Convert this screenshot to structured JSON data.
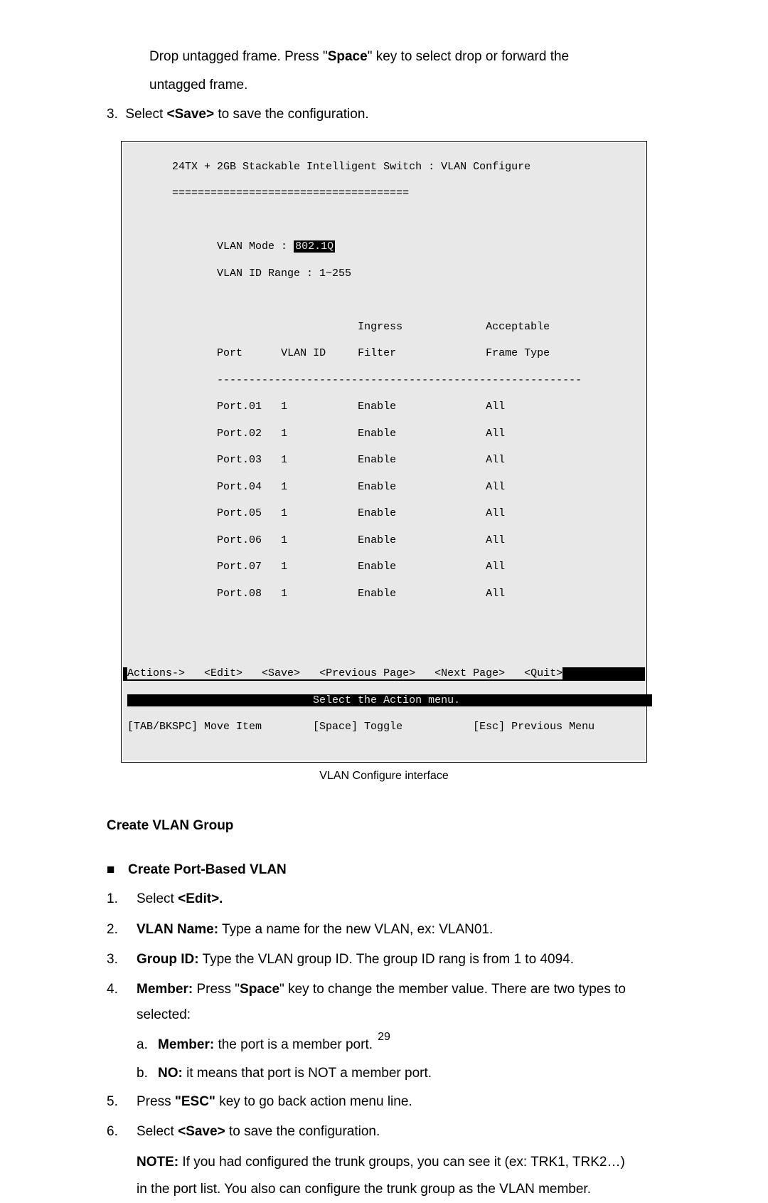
{
  "intro": {
    "line1_pre": "Drop untagged frame. Press \"",
    "line1_bold": "Space",
    "line1_post": "\" key to select drop or forward the",
    "line2": "untagged frame."
  },
  "step3": {
    "num": "3.",
    "pre": "Select ",
    "bold": "<Save>",
    "post": " to save the configuration."
  },
  "terminal": {
    "title": "24TX + 2GB Stackable Intelligent Switch : VLAN Configure",
    "divider": "=====================================",
    "vlan_mode_label": "VLAN Mode : ",
    "vlan_mode_value": "802.1Q",
    "vlan_id_range": "VLAN ID Range : 1~255",
    "hdr_port": "Port",
    "hdr_vlanid": "VLAN ID",
    "hdr_ingress1": "Ingress",
    "hdr_ingress2": "Filter",
    "hdr_accept1": "Acceptable",
    "hdr_accept2": "Frame Type",
    "hline": "---------------------------------------------------------",
    "rows": [
      {
        "port": "Port.01",
        "vid": "1",
        "filter": "Enable",
        "type": "All"
      },
      {
        "port": "Port.02",
        "vid": "1",
        "filter": "Enable",
        "type": "All"
      },
      {
        "port": "Port.03",
        "vid": "1",
        "filter": "Enable",
        "type": "All"
      },
      {
        "port": "Port.04",
        "vid": "1",
        "filter": "Enable",
        "type": "All"
      },
      {
        "port": "Port.05",
        "vid": "1",
        "filter": "Enable",
        "type": "All"
      },
      {
        "port": "Port.06",
        "vid": "1",
        "filter": "Enable",
        "type": "All"
      },
      {
        "port": "Port.07",
        "vid": "1",
        "filter": "Enable",
        "type": "All"
      },
      {
        "port": "Port.08",
        "vid": "1",
        "filter": "Enable",
        "type": "All"
      }
    ],
    "actions_prefix": "Actions->   ",
    "actions_edit": "<Edit>",
    "actions_save": "   <Save>   ",
    "actions_prev": "<Previous Page>",
    "actions_next": "   <Next Page>   ",
    "actions_quit": "<Quit>",
    "select_menu_pre": "                             ",
    "select_menu": "Select the Action menu.",
    "footer_left": "[TAB/BKSPC] Move Item",
    "footer_mid": "[Space] Toggle",
    "footer_right": "[Esc] Previous Menu"
  },
  "caption": "VLAN Configure interface",
  "section_title": "Create VLAN Group",
  "bullet_title": "Create Port-Based VLAN",
  "items": [
    {
      "num": "1.",
      "pre": "Select ",
      "bold": "<Edit>.",
      "post": ""
    },
    {
      "num": "2.",
      "pre": "",
      "bold": "VLAN Name:",
      "post": " Type a name for the new VLAN, ex: VLAN01."
    },
    {
      "num": "3.",
      "pre": "",
      "bold": "Group ID:",
      "post": " Type the VLAN group ID. The group ID rang is from 1 to 4094."
    }
  ],
  "item4": {
    "num": "4.",
    "bold": "Member:",
    "mid1": " Press \"",
    "bold2": "Space",
    "mid2": "\" key to change the member value. There are two types to",
    "line2": "selected:"
  },
  "sub_a": {
    "letter": "a.",
    "bold": "Member:",
    "post": " the port is a member port."
  },
  "sub_b": {
    "letter": "b.",
    "bold": "NO:",
    "post": " it means that port is NOT a member port."
  },
  "item5": {
    "num": "5.",
    "pre": "Press ",
    "bold": "\"ESC\"",
    "post": " key to go back action menu line."
  },
  "item6": {
    "num": "6.",
    "pre": "Select ",
    "bold": "<Save>",
    "post": " to save the configuration."
  },
  "note": {
    "bold": "NOTE:",
    "line1": " If you had configured the trunk groups, you can see it (ex: TRK1, TRK2…)",
    "line2": "in the port list. You also can configure the trunk group as the VLAN member."
  },
  "page_num": "29"
}
